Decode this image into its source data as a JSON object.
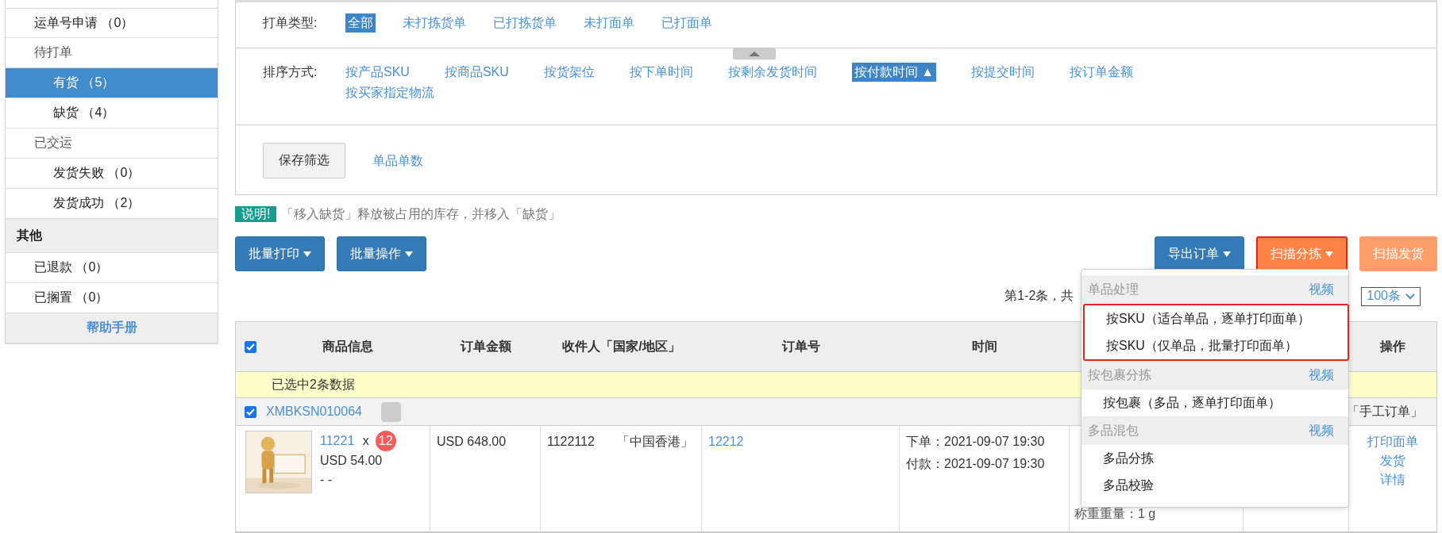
{
  "sidebar": {
    "items": [
      {
        "kind": "link",
        "label": "运单号申请 （0）",
        "selected": false
      },
      {
        "kind": "group",
        "label": "待打单",
        "selected": false,
        "children": [
          {
            "kind": "link",
            "label": "有货 （5）",
            "selected": true
          },
          {
            "kind": "link",
            "label": "缺货 （4）",
            "selected": false
          }
        ]
      },
      {
        "kind": "group",
        "label": "已交运",
        "selected": false,
        "children": [
          {
            "kind": "link",
            "label": "发货失败 （0）",
            "selected": false
          },
          {
            "kind": "link",
            "label": "发货成功 （2）",
            "selected": false
          }
        ]
      },
      {
        "kind": "section",
        "label": "其他",
        "selected": false
      },
      {
        "kind": "link",
        "label": "已退款 （0）",
        "selected": false
      },
      {
        "kind": "link",
        "label": "已搁置 （0）",
        "selected": false
      },
      {
        "kind": "help",
        "label": "帮助手册",
        "selected": false
      }
    ]
  },
  "filters": {
    "print_type": {
      "label": "打单类型:",
      "options": [
        {
          "label": "全部",
          "selected": true
        },
        {
          "label": "未打拣货单",
          "selected": false
        },
        {
          "label": "已打拣货单",
          "selected": false
        },
        {
          "label": "未打面单",
          "selected": false
        },
        {
          "label": "已打面单",
          "selected": false
        }
      ]
    },
    "sort": {
      "label": "排序方式:",
      "options": [
        {
          "label": "按产品SKU",
          "selected": false
        },
        {
          "label": "按商品SKU",
          "selected": false
        },
        {
          "label": "按货架位",
          "selected": false
        },
        {
          "label": "按下单时间",
          "selected": false
        },
        {
          "label": "按剩余发货时间",
          "selected": false
        },
        {
          "label": "按付款时间",
          "selected": true,
          "arrow": "▲"
        },
        {
          "label": "按提交时间",
          "selected": false
        },
        {
          "label": "按订单金额",
          "selected": false
        },
        {
          "label": "按买家指定物流",
          "selected": false
        }
      ]
    },
    "save_button": "保存筛选",
    "single_count_link": "单品单数"
  },
  "notice": {
    "badge": "说明!",
    "text": "「移入缺货」释放被占用的库存，并移入「缺货」"
  },
  "toolbar": {
    "left_buttons": [
      {
        "label": "批量打印",
        "caret": true,
        "kind": "primary",
        "highlighted": false
      },
      {
        "label": "批量操作",
        "caret": true,
        "kind": "primary",
        "highlighted": false
      }
    ],
    "right_buttons": [
      {
        "label": "导出订单",
        "caret": true,
        "kind": "primary",
        "highlighted": false
      },
      {
        "label": "扫描分拣",
        "caret": true,
        "kind": "orange",
        "highlighted": true
      },
      {
        "label": "扫描发货",
        "caret": false,
        "kind": "light-orange",
        "highlighted": false
      }
    ]
  },
  "dropdown": {
    "groups": [
      {
        "title": "单品处理",
        "video": "视频",
        "highlighted": true,
        "items": [
          "按SKU（适合单品，逐单打印面单）",
          "按SKU（仅单品，批量打印面单）"
        ]
      },
      {
        "title": "按包裹分拣",
        "video": "视频",
        "highlighted": false,
        "items": [
          "按包裹（多品，逐单打印面单）"
        ]
      },
      {
        "title": "多品混包",
        "video": "视频",
        "highlighted": false,
        "items": [
          "多品分拣",
          "多品校验"
        ]
      }
    ]
  },
  "pagination": {
    "summary": "第1-2条，共",
    "page_size": "100条"
  },
  "table": {
    "header_checked": true,
    "columns": [
      "商品信息",
      "订单金额",
      "收件人「国家/地区」",
      "订单号",
      "时间",
      "操作"
    ],
    "selection_notice": "已选中2条数据",
    "orders": [
      {
        "checked": true,
        "order_id": "XMBKSN010064",
        "source": "「手工订单」",
        "product_link": "11221",
        "times_sign": "x",
        "quantity": "12",
        "unit_price": "USD 54.00",
        "dash": "- -",
        "amount": "USD 648.00",
        "recipient": "1122112",
        "country": "「中国香港」",
        "order_no": "12212",
        "times": [
          "下单：2021-09-07 19:30",
          "付款：2021-09-07 19:30"
        ],
        "weight": "称重重量：1 g",
        "actions": [
          "打印面单",
          "发货",
          "详情"
        ]
      }
    ]
  }
}
